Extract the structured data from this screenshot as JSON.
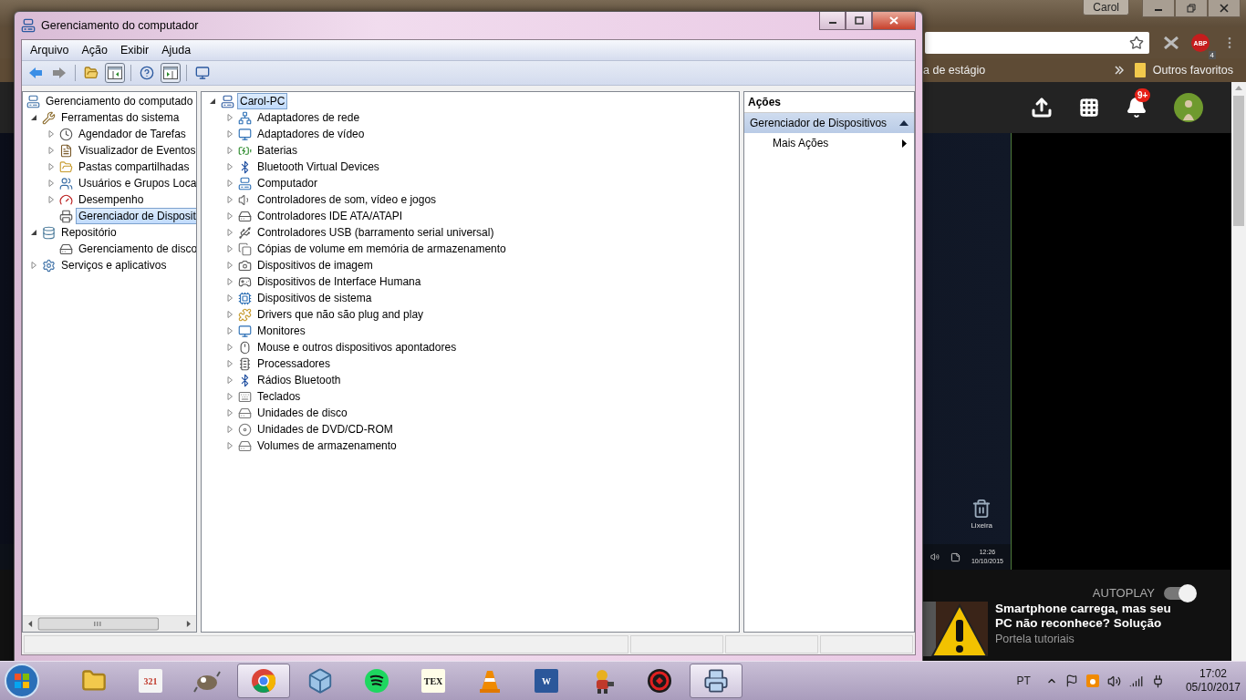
{
  "browser": {
    "profile": "Carol",
    "extension_badge": {
      "glyph": "ABP",
      "count": "4"
    },
    "bookmarks": [
      {
        "label": "a de estágio"
      }
    ],
    "other_bookmarks": "Outros favoritos",
    "notifications": "9+",
    "video_frame": {
      "recycle_bin": "Lixeira",
      "time": "12:26",
      "date": "10/10/2015"
    },
    "autoplay": {
      "label": "AUTOPLAY",
      "on": true
    },
    "suggestion": {
      "title": "Smartphone carrega, mas seu PC não reconhece? Solução",
      "channel": "Portela tutoriais"
    }
  },
  "window": {
    "title": "Gerenciamento do computador",
    "menu": [
      "Arquivo",
      "Ação",
      "Exibir",
      "Ajuda"
    ]
  },
  "tree": [
    {
      "label": "Gerenciamento do computado",
      "selected": false,
      "children": [
        {
          "label": "Ferramentas do sistema",
          "selected": false,
          "expanded": true,
          "children": [
            {
              "label": "Agendador de Tarefas",
              "selected": false,
              "expanded": false
            },
            {
              "label": "Visualizador de Eventos",
              "selected": false,
              "expanded": false
            },
            {
              "label": "Pastas compartilhadas",
              "selected": false,
              "expanded": false
            },
            {
              "label": "Usuários e Grupos Loca",
              "selected": false,
              "expanded": false
            },
            {
              "label": "Desempenho",
              "selected": false,
              "expanded": false
            },
            {
              "label": "Gerenciador de Disposit",
              "selected": true
            }
          ]
        },
        {
          "label": "Repositório",
          "selected": false,
          "expanded": true,
          "children": [
            {
              "label": "Gerenciamento de disco",
              "selected": false
            }
          ]
        },
        {
          "label": "Serviços e aplicativos",
          "selected": false,
          "expanded": false
        }
      ]
    }
  ],
  "devices": {
    "label": "Carol-PC",
    "selected": true,
    "expanded": true,
    "children": [
      {
        "label": "Adaptadores de rede",
        "selected": false,
        "expanded": false
      },
      {
        "label": "Adaptadores de vídeo",
        "selected": false,
        "expanded": false
      },
      {
        "label": "Baterias",
        "selected": false,
        "expanded": false
      },
      {
        "label": "Bluetooth Virtual Devices",
        "selected": false,
        "expanded": false
      },
      {
        "label": "Computador",
        "selected": false,
        "expanded": false
      },
      {
        "label": "Controladores de som, vídeo e jogos",
        "selected": false,
        "expanded": false
      },
      {
        "label": "Controladores IDE ATA/ATAPI",
        "selected": false,
        "expanded": false
      },
      {
        "label": "Controladores USB (barramento serial universal)",
        "selected": false,
        "expanded": false
      },
      {
        "label": "Cópias de volume em memória de armazenamento",
        "selected": false,
        "expanded": false
      },
      {
        "label": "Dispositivos de imagem",
        "selected": false,
        "expanded": false
      },
      {
        "label": "Dispositivos de Interface Humana",
        "selected": false,
        "expanded": false
      },
      {
        "label": "Dispositivos de sistema",
        "selected": false,
        "expanded": false
      },
      {
        "label": "Drivers que não são plug and play",
        "selected": false,
        "expanded": false
      },
      {
        "label": "Monitores",
        "selected": false,
        "expanded": false
      },
      {
        "label": "Mouse e outros dispositivos apontadores",
        "selected": false,
        "expanded": false
      },
      {
        "label": "Processadores",
        "selected": false,
        "expanded": false
      },
      {
        "label": "Rádios Bluetooth",
        "selected": false,
        "expanded": false
      },
      {
        "label": "Teclados",
        "selected": false,
        "expanded": false
      },
      {
        "label": "Unidades de disco",
        "selected": false,
        "expanded": false
      },
      {
        "label": "Unidades de DVD/CD-ROM",
        "selected": false,
        "expanded": false
      },
      {
        "label": "Volumes de armazenamento",
        "selected": false,
        "expanded": false
      }
    ]
  },
  "actions": {
    "header": "Ações",
    "sections": [
      {
        "title": "Gerenciador de Dispositivos",
        "expanded": true,
        "items": [
          {
            "label": "Mais Ações"
          }
        ]
      }
    ]
  },
  "taskbar": {
    "apps": [
      {
        "kind": "explorer",
        "selected": false
      },
      {
        "kind": "media",
        "glyph": "321",
        "selected": false
      },
      {
        "kind": "gimp",
        "selected": false
      },
      {
        "kind": "chrome",
        "selected": true
      },
      {
        "kind": "cube",
        "selected": false
      },
      {
        "kind": "spotify",
        "selected": false
      },
      {
        "kind": "tex",
        "glyph": "TEX",
        "selected": false
      },
      {
        "kind": "vlc",
        "selected": false
      },
      {
        "kind": "word",
        "glyph": "W",
        "selected": false
      },
      {
        "kind": "game",
        "selected": false
      },
      {
        "kind": "shield",
        "selected": false
      },
      {
        "kind": "devmgr",
        "selected": true
      }
    ],
    "language": "PT",
    "time": "17:02",
    "date": "05/10/2017"
  }
}
